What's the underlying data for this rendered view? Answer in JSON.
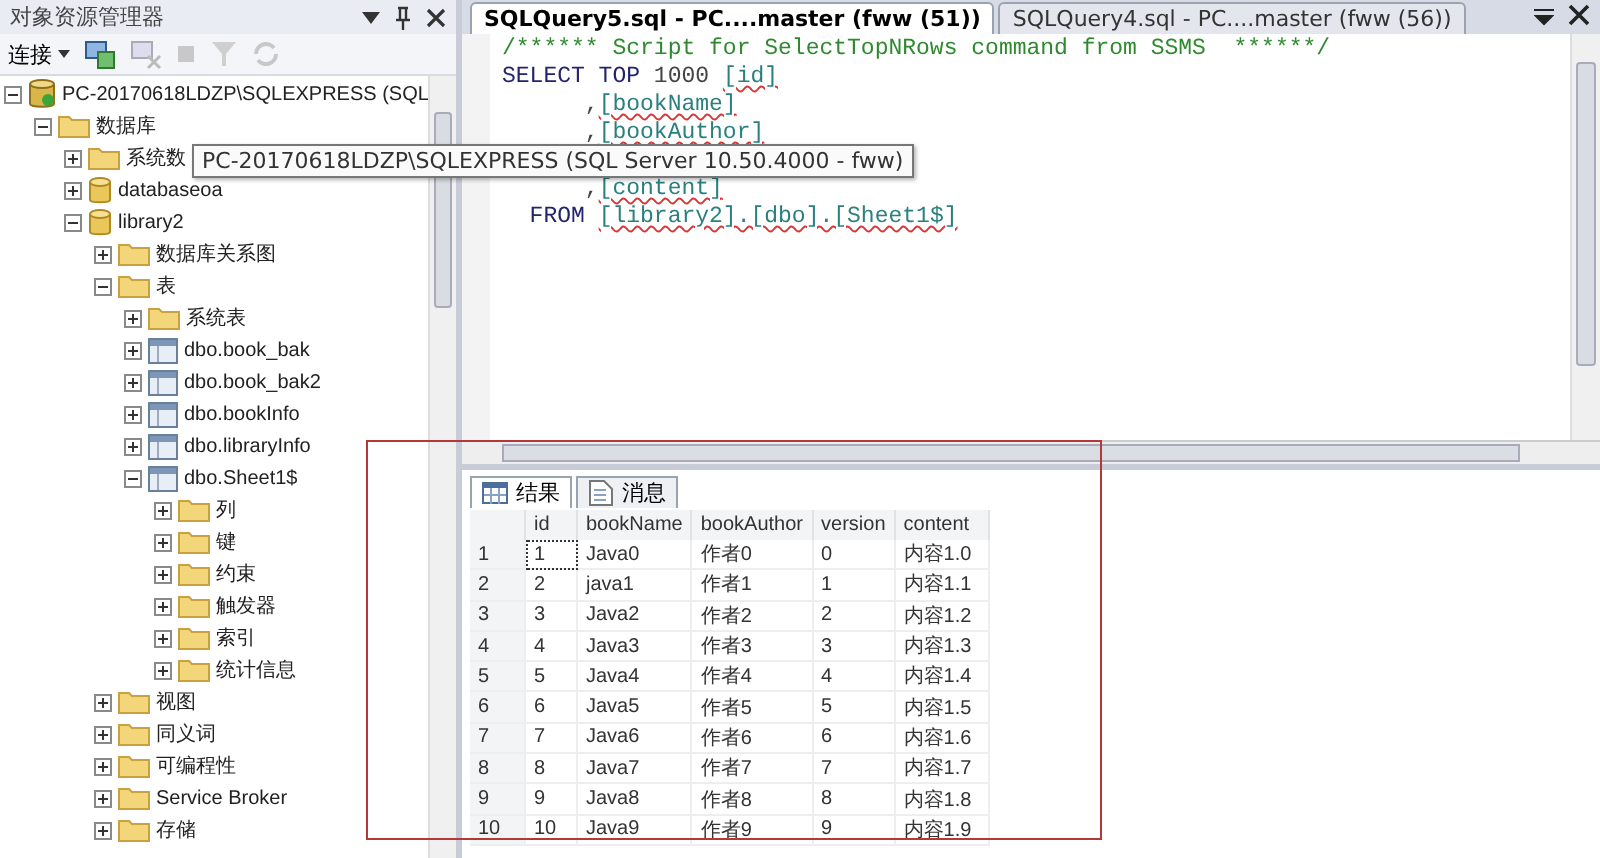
{
  "explorer": {
    "title": "对象资源管理器",
    "toolbar": {
      "connect_label": "连接"
    },
    "tree": [
      {
        "label": "PC-20170618LDZP\\SQLEXPRESS (SQL",
        "kind": "server",
        "expanded": true,
        "children": [
          {
            "label": "数据库",
            "kind": "folder",
            "expanded": true,
            "children": [
              {
                "label": "系统数",
                "kind": "folder",
                "expanded": false
              },
              {
                "label": "databaseoa",
                "kind": "database",
                "expanded": false
              },
              {
                "label": "library2",
                "kind": "database",
                "expanded": true,
                "children": [
                  {
                    "label": "数据库关系图",
                    "kind": "folder",
                    "expanded": false
                  },
                  {
                    "label": "表",
                    "kind": "folder",
                    "expanded": true,
                    "children": [
                      {
                        "label": "系统表",
                        "kind": "folder",
                        "expanded": false
                      },
                      {
                        "label": "dbo.book_bak",
                        "kind": "table",
                        "expanded": false
                      },
                      {
                        "label": "dbo.book_bak2",
                        "kind": "table",
                        "expanded": false
                      },
                      {
                        "label": "dbo.bookInfo",
                        "kind": "table",
                        "expanded": false
                      },
                      {
                        "label": "dbo.libraryInfo",
                        "kind": "table",
                        "expanded": false
                      },
                      {
                        "label": "dbo.Sheet1$",
                        "kind": "table",
                        "expanded": true,
                        "children": [
                          {
                            "label": "列",
                            "kind": "folder",
                            "expanded": false
                          },
                          {
                            "label": "键",
                            "kind": "folder",
                            "expanded": false
                          },
                          {
                            "label": "约束",
                            "kind": "folder",
                            "expanded": false
                          },
                          {
                            "label": "触发器",
                            "kind": "folder",
                            "expanded": false
                          },
                          {
                            "label": "索引",
                            "kind": "folder",
                            "expanded": false
                          },
                          {
                            "label": "统计信息",
                            "kind": "folder",
                            "expanded": false
                          }
                        ]
                      }
                    ]
                  },
                  {
                    "label": "视图",
                    "kind": "folder",
                    "expanded": false
                  },
                  {
                    "label": "同义词",
                    "kind": "folder",
                    "expanded": false
                  },
                  {
                    "label": "可编程性",
                    "kind": "folder",
                    "expanded": false
                  },
                  {
                    "label": "Service Broker",
                    "kind": "folder",
                    "expanded": false
                  },
                  {
                    "label": "存储",
                    "kind": "folder",
                    "expanded": false
                  }
                ]
              }
            ]
          }
        ]
      }
    ]
  },
  "tooltip": "PC-20170618LDZP\\SQLEXPRESS (SQL Server 10.50.4000 - fww)",
  "tabs": [
    {
      "label": "SQLQuery5.sql - PC....master (fww (51))",
      "selected": true
    },
    {
      "label": "SQLQuery4.sql - PC....master (fww (56))",
      "selected": false
    }
  ],
  "editor": {
    "lines": [
      {
        "covered": false,
        "segments": [
          {
            "kind": "comment",
            "text": "/****** Script for SelectTopNRows command from SSMS  ******/"
          }
        ]
      },
      {
        "covered": false,
        "segments": [
          {
            "kind": "keyword",
            "text": "SELECT TOP "
          },
          {
            "kind": "plain",
            "text": "1000 "
          },
          {
            "kind": "ident",
            "text": "[id]"
          }
        ]
      },
      {
        "covered": false,
        "segments": [
          {
            "kind": "plain",
            "text": "      ,"
          },
          {
            "kind": "ident",
            "text": "[bookName]"
          }
        ]
      },
      {
        "covered": false,
        "segments": [
          {
            "kind": "plain",
            "text": "      ,"
          },
          {
            "kind": "ident",
            "text": "[bookAuthor]"
          }
        ]
      },
      {
        "covered": true
      },
      {
        "covered": false,
        "segments": [
          {
            "kind": "plain",
            "text": "      ,"
          },
          {
            "kind": "ident",
            "text": "[content]"
          }
        ]
      },
      {
        "covered": false,
        "segments": [
          {
            "kind": "keyword",
            "text": "  FROM "
          },
          {
            "kind": "ident",
            "text": "[library2].[dbo].[Sheet1$]"
          }
        ]
      }
    ]
  },
  "results": {
    "tabs": [
      {
        "label": "结果",
        "kind": "grid",
        "selected": true
      },
      {
        "label": "消息",
        "kind": "messages",
        "selected": false
      }
    ],
    "columns": [
      "id",
      "bookName",
      "bookAuthor",
      "version",
      "content"
    ],
    "rows": [
      {
        "number": "1",
        "cells": [
          "1",
          "Java0",
          "作者0",
          "0",
          "内容1.0"
        ]
      },
      {
        "number": "2",
        "cells": [
          "2",
          "java1",
          "作者1",
          "1",
          "内容1.1"
        ]
      },
      {
        "number": "3",
        "cells": [
          "3",
          "Java2",
          "作者2",
          "2",
          "内容1.2"
        ]
      },
      {
        "number": "4",
        "cells": [
          "4",
          "Java3",
          "作者3",
          "3",
          "内容1.3"
        ]
      },
      {
        "number": "5",
        "cells": [
          "5",
          "Java4",
          "作者4",
          "4",
          "内容1.4"
        ]
      },
      {
        "number": "6",
        "cells": [
          "6",
          "Java5",
          "作者5",
          "5",
          "内容1.5"
        ]
      },
      {
        "number": "7",
        "cells": [
          "7",
          "Java6",
          "作者6",
          "6",
          "内容1.6"
        ]
      },
      {
        "number": "8",
        "cells": [
          "8",
          "Java7",
          "作者7",
          "7",
          "内容1.7"
        ]
      },
      {
        "number": "9",
        "cells": [
          "9",
          "Java8",
          "作者8",
          "8",
          "内容1.8"
        ]
      },
      {
        "number": "10",
        "cells": [
          "10",
          "Java9",
          "作者9",
          "9",
          "内容1.9"
        ]
      }
    ]
  }
}
